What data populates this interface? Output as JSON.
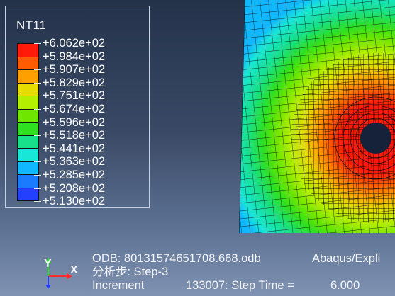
{
  "legend": {
    "title": "NT11",
    "labels": [
      "+6.062e+02",
      "+5.984e+02",
      "+5.907e+02",
      "+5.829e+02",
      "+5.751e+02",
      "+5.674e+02",
      "+5.596e+02",
      "+5.518e+02",
      "+5.441e+02",
      "+5.363e+02",
      "+5.285e+02",
      "+5.208e+02",
      "+5.130e+02"
    ],
    "colors": [
      "#ff1a0a",
      "#ff5b00",
      "#ff9f00",
      "#e6dc00",
      "#b4ee00",
      "#6ee600",
      "#2fe020",
      "#18e08a",
      "#19e6d6",
      "#12b8ff",
      "#1a7bff",
      "#2340ff",
      "#1a14f5"
    ]
  },
  "triad": {
    "y_label": "Y",
    "x_label": "X"
  },
  "info": {
    "odb": "ODB: 80131574651708.668.odb",
    "product": "Abaqus/Expli",
    "step": "分析步: Step-3",
    "increment": "Increment",
    "increment_value": "133007: Step Time =",
    "step_time": "6.000"
  }
}
